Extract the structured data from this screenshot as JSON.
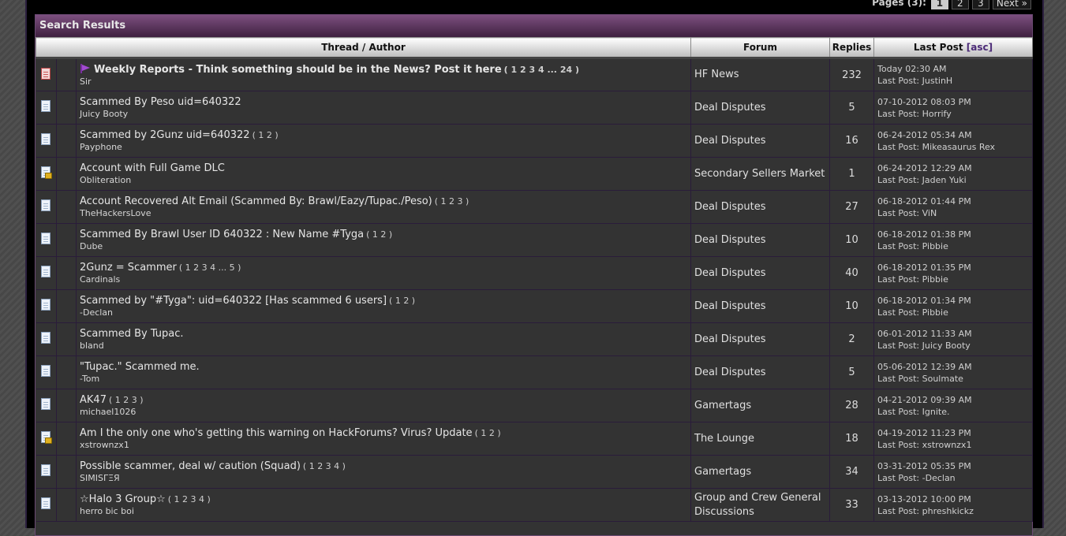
{
  "pager": {
    "label": "Pages (3):",
    "pages": [
      "1",
      "2",
      "3"
    ],
    "active": "1",
    "next": "Next »"
  },
  "panel": {
    "title": "Search Results"
  },
  "columns": {
    "thread": "Thread / Author",
    "forum": "Forum",
    "replies": "Replies",
    "last_post": "Last Post",
    "asc": "[asc]"
  },
  "rows": [
    {
      "icon": "hot-thread-icon",
      "sticky": true,
      "title": "Weekly Reports - Think something should be in the News? Post it here",
      "pages": "( 1 2 3 4 ... 24 )",
      "author": "Sir",
      "forum": "HF News",
      "replies": "232",
      "date": "Today 02:30 AM",
      "last": "Last Post: JustinH"
    },
    {
      "icon": "thread-icon",
      "sticky": false,
      "title": "Scammed By Peso uid=640322",
      "pages": "",
      "author": "Juicy Booty",
      "forum": "Deal Disputes",
      "replies": "5",
      "date": "07-10-2012 08:03 PM",
      "last": "Last Post: Horrify"
    },
    {
      "icon": "thread-icon",
      "sticky": false,
      "title": "Scammed by 2Gunz uid=640322",
      "pages": "( 1 2 )",
      "author": "Payphone",
      "forum": "Deal Disputes",
      "replies": "16",
      "date": "06-24-2012 05:34 AM",
      "last": "Last Post: Mikeasaurus Rex"
    },
    {
      "icon": "locked-thread-icon",
      "sticky": false,
      "title": "Account with Full Game DLC",
      "pages": "",
      "author": "Obliteration",
      "forum": "Secondary Sellers Market",
      "replies": "1",
      "date": "06-24-2012 12:29 AM",
      "last": "Last Post: Jaden Yuki"
    },
    {
      "icon": "thread-icon",
      "sticky": false,
      "title": "Account Recovered Alt Email (Scammed By: Brawl/Eazy/Tupac./Peso)",
      "pages": "( 1 2 3 )",
      "author": "TheHackersLove",
      "forum": "Deal Disputes",
      "replies": "27",
      "date": "06-18-2012 01:44 PM",
      "last": "Last Post: ViN"
    },
    {
      "icon": "thread-icon",
      "sticky": false,
      "title": "Scammed By Brawl User ID 640322 : New Name #Tyga",
      "pages": "( 1 2 )",
      "author": "Dube",
      "forum": "Deal Disputes",
      "replies": "10",
      "date": "06-18-2012 01:38 PM",
      "last": "Last Post: Pibbie"
    },
    {
      "icon": "thread-icon",
      "sticky": false,
      "title": "2Gunz = Scammer",
      "pages": "( 1 2 3 4 ... 5 )",
      "author": "Cardinals",
      "forum": "Deal Disputes",
      "replies": "40",
      "date": "06-18-2012 01:35 PM",
      "last": "Last Post: Pibbie"
    },
    {
      "icon": "thread-icon",
      "sticky": false,
      "title": "Scammed by \"#Tyga\": uid=640322 [Has scammed 6 users]",
      "pages": "( 1 2 )",
      "author": "-Declan",
      "forum": "Deal Disputes",
      "replies": "10",
      "date": "06-18-2012 01:34 PM",
      "last": "Last Post: Pibbie"
    },
    {
      "icon": "thread-icon",
      "sticky": false,
      "title": "Scammed By Tupac.",
      "pages": "",
      "author": "bland",
      "forum": "Deal Disputes",
      "replies": "2",
      "date": "06-01-2012 11:33 AM",
      "last": "Last Post: Juicy Booty"
    },
    {
      "icon": "thread-icon",
      "sticky": false,
      "title": "\"Tupac.\" Scammed me.",
      "pages": "",
      "author": "-Tom",
      "forum": "Deal Disputes",
      "replies": "5",
      "date": "05-06-2012 12:39 AM",
      "last": "Last Post: Soulmate"
    },
    {
      "icon": "thread-icon",
      "sticky": false,
      "title": "AK47",
      "pages": "( 1 2 3 )",
      "author": "michael1026",
      "forum": "Gamertags",
      "replies": "28",
      "date": "04-21-2012 09:39 AM",
      "last": "Last Post: Ignite."
    },
    {
      "icon": "locked-thread-icon",
      "sticky": false,
      "title": "Am I the only one who's getting this warning on HackForums? Virus? Update",
      "pages": "( 1 2 )",
      "author": "xstrownzx1",
      "forum": "The Lounge",
      "replies": "18",
      "date": "04-19-2012 11:23 PM",
      "last": "Last Post: xstrownzx1"
    },
    {
      "icon": "thread-icon",
      "sticky": false,
      "title": "Possible scammer, deal w/ caution (Squad)",
      "pages": "( 1 2 3 4 )",
      "author": "SIΜISΓΞЯ",
      "forum": "Gamertags",
      "replies": "34",
      "date": "03-31-2012 05:35 PM",
      "last": "Last Post: -Declan"
    },
    {
      "icon": "thread-icon",
      "sticky": false,
      "title": "☆Halo 3 Group☆",
      "pages": "( 1 2 3 4 )",
      "author": "herro bic boi",
      "forum": "Group and Crew General Discussions",
      "replies": "33",
      "date": "03-13-2012 10:00 PM",
      "last": "Last Post: phreshkickz"
    }
  ]
}
